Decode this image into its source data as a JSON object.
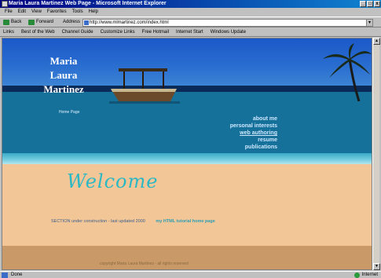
{
  "window": {
    "title": "Maria Laura Martinez Web Page - Microsoft Internet Explorer",
    "controls": [
      "_",
      "□",
      "x"
    ]
  },
  "menu": [
    "File",
    "Edit",
    "View",
    "Favorites",
    "Tools",
    "Help"
  ],
  "toolbar": {
    "back_label": "Back",
    "forward_label": "Forward",
    "address_label": "Address",
    "address_value": "http://www.mlmartinez.com/index.html",
    "go_label": "▾"
  },
  "links_bar": [
    "Links",
    "Best of the Web",
    "Channel Guide",
    "Customize Links",
    "Free Hotmail",
    "Internet Start",
    "Windows Update"
  ],
  "page": {
    "name_lines": [
      "Maria",
      "Laura",
      "Martinez"
    ],
    "subtitle": "Home Page",
    "nav": [
      {
        "label": "about me",
        "underline": false
      },
      {
        "label": "personal interests",
        "underline": false
      },
      {
        "label": "web authoring",
        "underline": true
      },
      {
        "label": "resume",
        "underline": false
      },
      {
        "label": "publications",
        "underline": false
      }
    ],
    "welcome": "Welcome",
    "intro": "SECTION under construction - last updated 2000",
    "intro_link": "my HTML tutorial home page",
    "footer": "copyright Maria Laura Martinez - all rights reserved"
  },
  "status": {
    "text": "Done",
    "zone": "Internet"
  },
  "colors": {
    "titlebar": "#000080",
    "sky": "#1a58c8",
    "sea": "#15709a",
    "sand": "#f2c697",
    "welcome": "#2ab8c4"
  }
}
